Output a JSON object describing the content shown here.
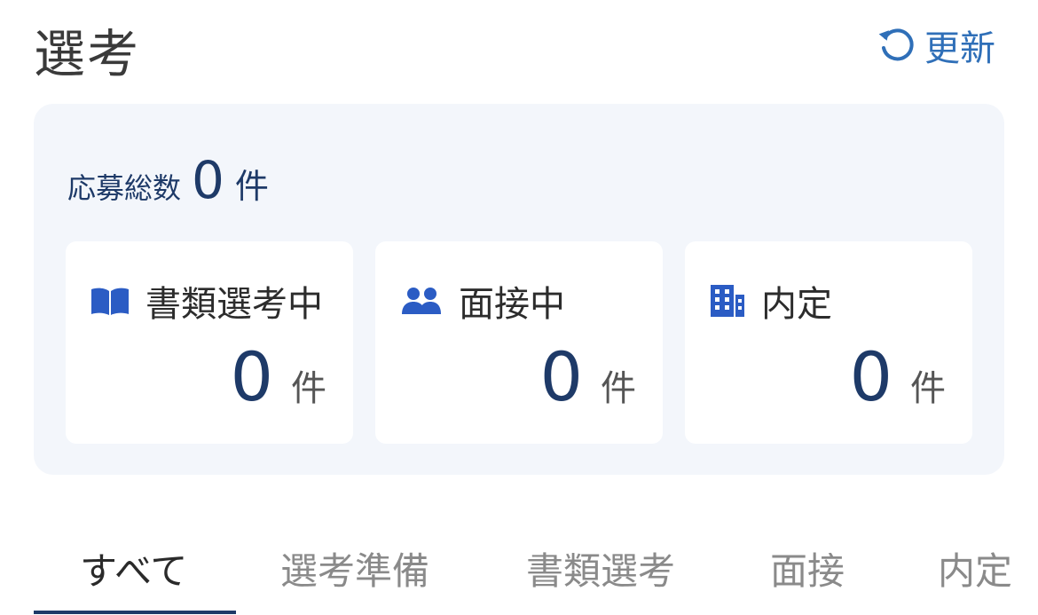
{
  "header": {
    "title": "選考",
    "refresh_label": "更新",
    "refresh_icon": "refresh-icon"
  },
  "summary": {
    "total_label": "応募総数",
    "total_count": "0",
    "total_unit": "件"
  },
  "stats": [
    {
      "icon": "book-icon",
      "label": "書類選考中",
      "count": "0",
      "unit": "件"
    },
    {
      "icon": "users-icon",
      "label": "面接中",
      "count": "0",
      "unit": "件"
    },
    {
      "icon": "building-icon",
      "label": "内定",
      "count": "0",
      "unit": "件"
    }
  ],
  "tabs": [
    {
      "label": "すべて",
      "active": true
    },
    {
      "label": "選考準備",
      "active": false
    },
    {
      "label": "書類選考",
      "active": false
    },
    {
      "label": "面接",
      "active": false
    },
    {
      "label": "内定",
      "active": false
    }
  ],
  "colors": {
    "accent": "#1e3a68",
    "icon_blue": "#2b5cc4",
    "link_blue": "#2f6fb8",
    "card_bg": "#f3f6fb"
  }
}
